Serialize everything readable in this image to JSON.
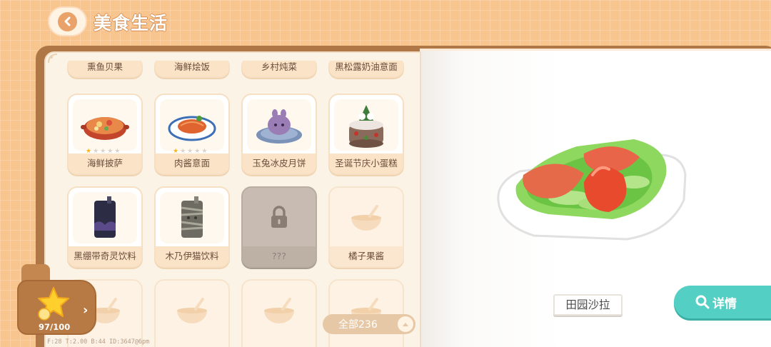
{
  "header": {
    "title": "美食生活"
  },
  "grid": {
    "top_row": [
      "熏鱼贝果",
      "海鲜烩饭",
      "乡村炖菜",
      "黑松露奶油意面"
    ],
    "row1": [
      {
        "label": "海鲜披萨",
        "stars": 1,
        "max_stars": 5,
        "icon": "seafood-pizza-icon"
      },
      {
        "label": "肉酱意面",
        "stars": 1,
        "max_stars": 5,
        "icon": "bolognese-pasta-icon"
      },
      {
        "label": "玉兔冰皮月饼",
        "icon": "jade-rabbit-mooncake-icon"
      },
      {
        "label": "圣诞节庆小蛋糕",
        "icon": "christmas-cake-icon"
      }
    ],
    "row2": [
      {
        "label": "黑绷带奇灵饮料",
        "icon": "black-bandage-drink-icon"
      },
      {
        "label": "木乃伊猫饮料",
        "icon": "mummy-cat-drink-icon"
      },
      {
        "label": "???",
        "icon": "lock-icon",
        "locked": true
      },
      {
        "label": "橘子果酱",
        "icon": "bowl-placeholder-icon",
        "empty": true
      }
    ]
  },
  "badge": {
    "progress": "97/100",
    "icon": "star-icon"
  },
  "filter": {
    "label": "全部236"
  },
  "preview": {
    "dish_name": "田园沙拉",
    "detail_label": "详情"
  },
  "debug": "F:28   T:2.00   B:44   ID:3647@6pm",
  "colors": {
    "accent_teal": "#54cfc4",
    "bg_orange": "#f8c58f",
    "star_gold": "#f6b71d"
  }
}
